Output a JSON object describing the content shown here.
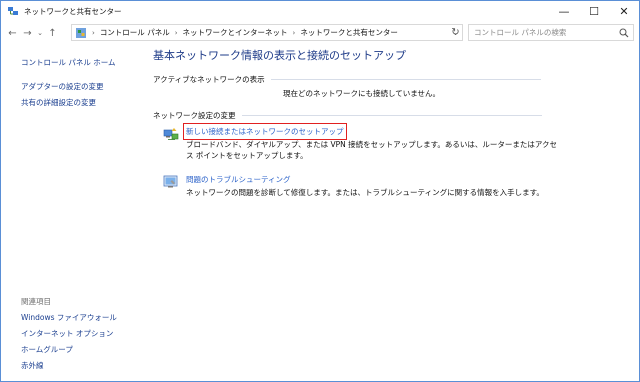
{
  "window": {
    "title": "ネットワークと共有センター",
    "buttons": {
      "minimize": "—",
      "maximize": "☐",
      "close": "✕"
    }
  },
  "address_bar": {
    "nav": {
      "back": "←",
      "forward": "→",
      "recent": "⌄",
      "up": "↑"
    },
    "breadcrumbs": [
      "コントロール パネル",
      "ネットワークとインターネット",
      "ネットワークと共有センター"
    ],
    "separator": "›",
    "dropdown": "⌄",
    "refresh": "↻"
  },
  "search": {
    "placeholder": "コントロール パネルの検索",
    "value": ""
  },
  "sidebar": {
    "home": "コントロール パネル ホーム",
    "links": [
      "アダプターの設定の変更",
      "共有の詳細設定の変更"
    ],
    "related_heading": "関連項目",
    "related": [
      "Windows ファイアウォール",
      "インターネット オプション",
      "ホームグループ",
      "赤外線"
    ]
  },
  "main": {
    "title": "基本ネットワーク情報の表示と接続のセットアップ",
    "active_networks_heading": "アクティブなネットワークの表示",
    "no_network_text": "現在どのネットワークにも接続していません。",
    "change_settings_heading": "ネットワーク設定の変更",
    "tasks": [
      {
        "icon": "network-setup-icon",
        "label": "新しい接続またはネットワークのセットアップ",
        "description": "ブロードバンド、ダイヤルアップ、または VPN 接続をセットアップします。あるいは、ルーターまたはアクセス ポイントをセットアップします。",
        "highlighted": true
      },
      {
        "icon": "troubleshoot-icon",
        "label": "問題のトラブルシューティング",
        "description": "ネットワークの問題を診断して修復します。または、トラブルシューティングに関する情報を入手します。",
        "highlighted": false
      }
    ]
  },
  "colors": {
    "link": "#1a3e8f",
    "task_link": "#2b62c9",
    "title": "#1e3b88",
    "highlight_border": "#e12020",
    "window_border": "#5a8fd6"
  }
}
